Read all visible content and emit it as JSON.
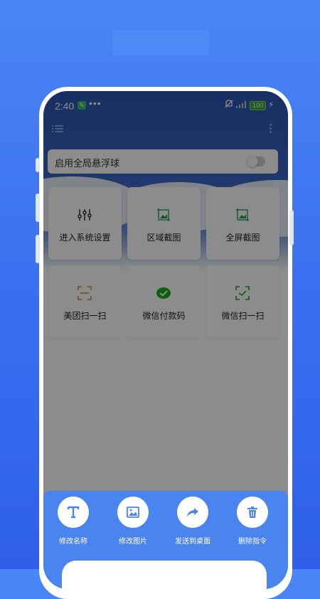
{
  "status_bar": {
    "time": "2:40",
    "app_badge": "✎",
    "dots": "•••",
    "mute_icon": "🔕",
    "signal": "ull",
    "battery": "100",
    "charging": "⚡"
  },
  "toggle": {
    "label": "启用全局悬浮球",
    "enabled": false
  },
  "tiles": [
    {
      "label": "进入系统设置",
      "icon": "sliders-icon"
    },
    {
      "label": "区域截图",
      "icon": "area-screenshot-icon"
    },
    {
      "label": "全屏截图",
      "icon": "fullscreen-screenshot-icon"
    },
    {
      "label": "美团扫一扫",
      "icon": "meituan-scan-icon"
    },
    {
      "label": "微信付款码",
      "icon": "wechat-pay-icon"
    },
    {
      "label": "微信扫一扫",
      "icon": "wechat-scan-icon"
    }
  ],
  "sheet": {
    "actions": [
      {
        "label": "修改名称",
        "icon": "text-icon"
      },
      {
        "label": "修改图片",
        "icon": "image-icon"
      },
      {
        "label": "发送到桌面",
        "icon": "share-icon"
      },
      {
        "label": "删除指令",
        "icon": "trash-icon"
      }
    ]
  },
  "colors": {
    "background": "#3b6ff0",
    "sheet": "#4a84ef",
    "accent_green": "#1aad19",
    "accent_orange": "#c99a3a"
  }
}
